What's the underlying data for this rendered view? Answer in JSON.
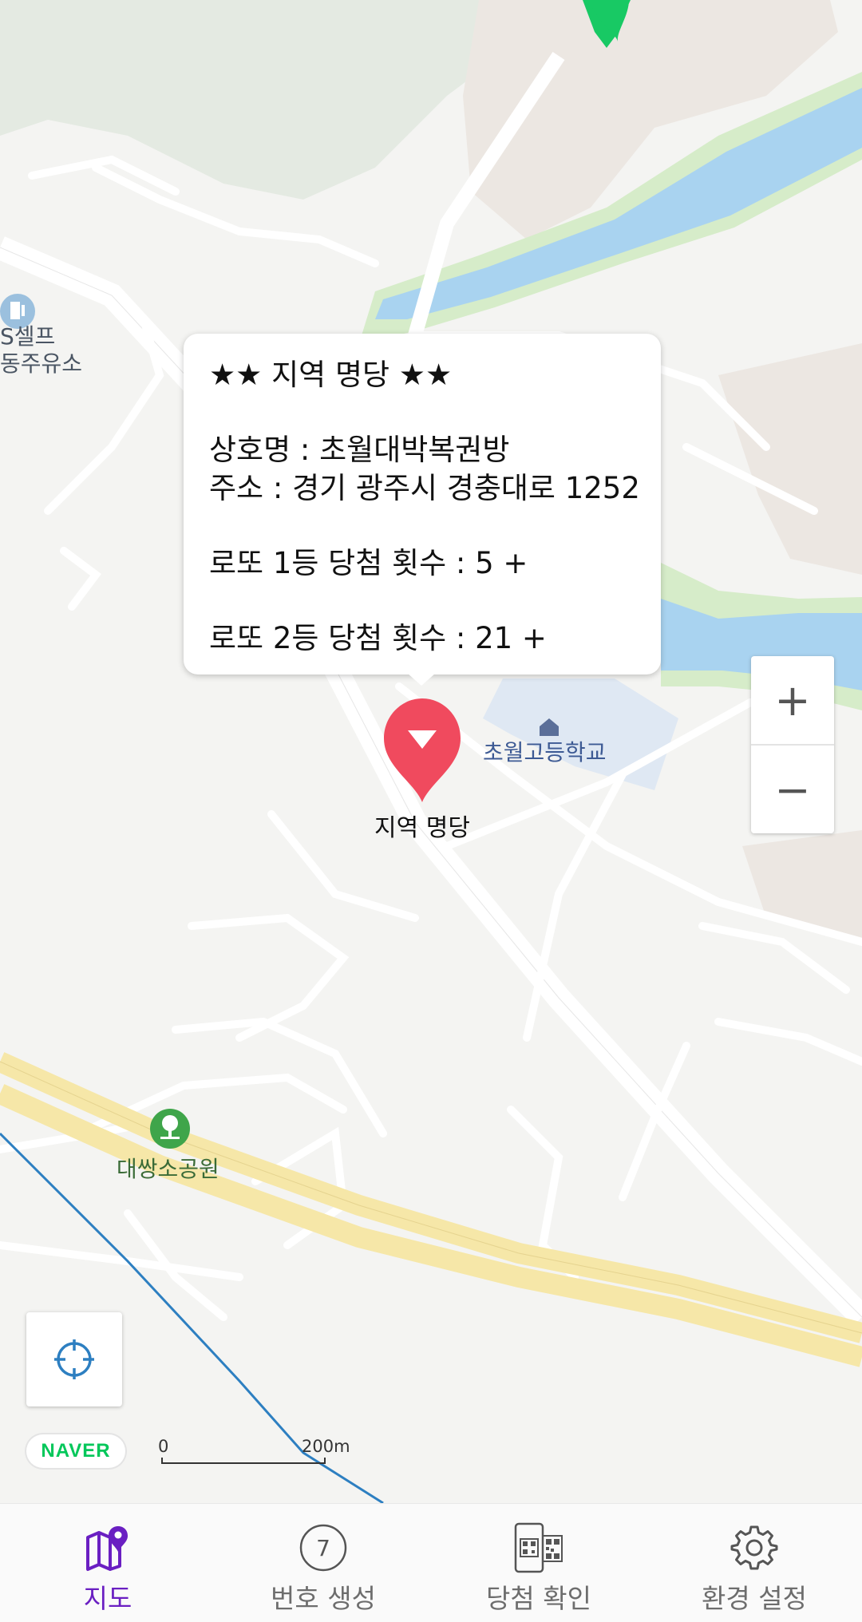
{
  "map": {
    "gas_station_line1": "S셀프",
    "gas_station_line2": "동주유소",
    "school_label": "초월고등학교",
    "park_label": "대쌍소공원",
    "marker_label": "지역 명당"
  },
  "popup": {
    "title": "★★ 지역 명당 ★★",
    "store_name": "상호명 : 초월대박복권방",
    "address": "주소 : 경기 광주시 경충대로 1252",
    "first_prize": "로또 1등 당첨 횟수 :  5 +",
    "second_prize": "로또 2등 당첨 횟수 :  21 +"
  },
  "controls": {
    "zoom_in_label": "+",
    "zoom_out_label": "−",
    "locate_icon": "crosshair-icon",
    "logo_text": "NAVER",
    "scale_zero": "0",
    "scale_max": "200m"
  },
  "bottom_nav": {
    "items": [
      {
        "label": "지도",
        "icon": "map-pin-icon",
        "active": true
      },
      {
        "label": "번호 생성",
        "icon": "number-ball-icon",
        "ball_number": "7"
      },
      {
        "label": "당첨 확인",
        "icon": "qr-scan-icon"
      },
      {
        "label": "환경 설정",
        "icon": "gear-icon"
      }
    ]
  },
  "colors": {
    "accent": "#6a1fc2",
    "marker": "#f04a5e",
    "green_marker": "#18c964",
    "river": "#a9d3f0",
    "river_bank": "#d6ecc9",
    "highway": "#f6e7a8",
    "school_area": "#dfe8f3"
  }
}
